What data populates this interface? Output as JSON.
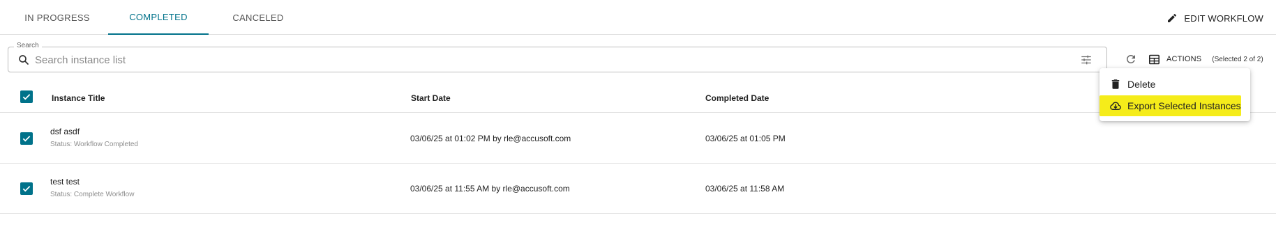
{
  "tabs": {
    "in_progress": "IN PROGRESS",
    "completed": "COMPLETED",
    "canceled": "CANCELED"
  },
  "toolbar": {
    "edit_workflow": "EDIT WORKFLOW",
    "actions": "ACTIONS",
    "selected": "(Selected 2 of 2)"
  },
  "search": {
    "label": "Search",
    "placeholder": "Search instance list",
    "value": ""
  },
  "table": {
    "columns": {
      "title": "Instance Title",
      "start": "Start Date",
      "completed": "Completed Date"
    },
    "rows": [
      {
        "title": "dsf asdf",
        "status": "Status: Workflow Completed",
        "start": "03/06/25 at 01:02 PM by rle@accusoft.com",
        "completed": "03/06/25 at 01:05 PM",
        "checked": true
      },
      {
        "title": "test test",
        "status": "Status: Complete Workflow",
        "start": "03/06/25 at 11:55 AM by rle@accusoft.com",
        "completed": "03/06/25 at 11:58 AM",
        "checked": true
      }
    ]
  },
  "menu": {
    "items": [
      {
        "label": "Delete",
        "icon": "trash-icon"
      },
      {
        "label": "Export Selected Instances",
        "icon": "cloud-download-icon",
        "highlighted": true
      }
    ]
  },
  "colors": {
    "accent": "#00728a",
    "highlight": "#f5ec1a",
    "divider": "#e0e0e0"
  }
}
